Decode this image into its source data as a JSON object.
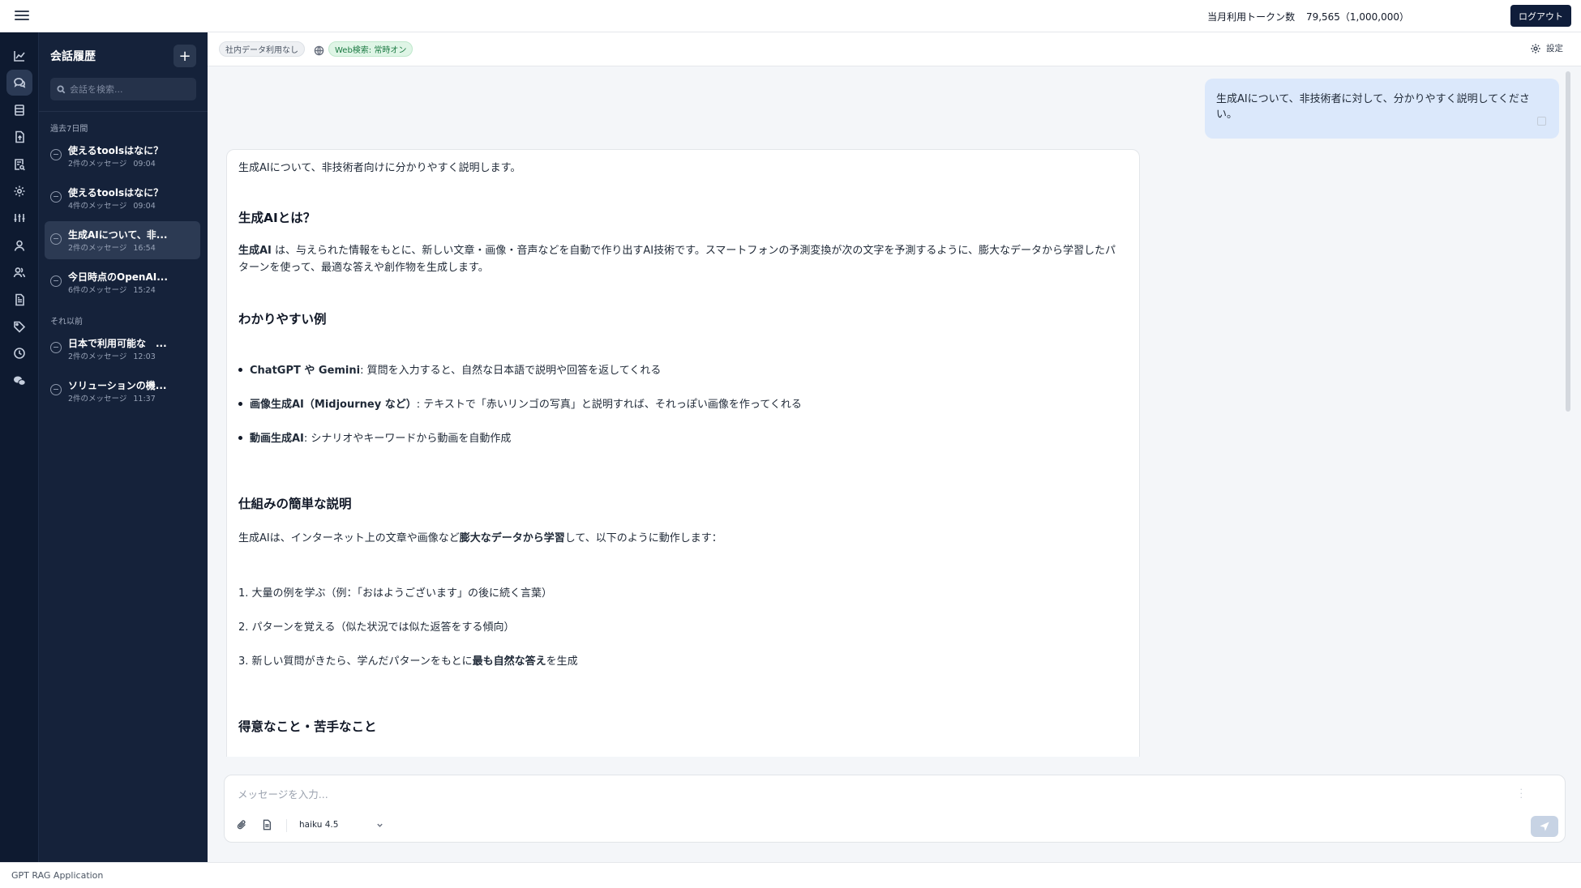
{
  "header": {
    "menu_icon": "hamburger-icon",
    "token_label": "当月利用トークン数",
    "token_value": "79,565（1,000,000）",
    "logout_label": "ログアウト"
  },
  "rail": {
    "items": [
      {
        "icon": "chart-line-icon"
      },
      {
        "icon": "chat-bubbles-icon",
        "active": true
      },
      {
        "icon": "table-icon"
      },
      {
        "icon": "document-upload-icon"
      },
      {
        "icon": "document-search-icon"
      },
      {
        "icon": "gear-icon"
      },
      {
        "icon": "sliders-icon"
      },
      {
        "icon": "user-icon"
      },
      {
        "icon": "users-icon"
      },
      {
        "icon": "document-text-icon"
      },
      {
        "icon": "tag-icon"
      },
      {
        "icon": "history-icon"
      },
      {
        "icon": "wechat-icon"
      }
    ]
  },
  "history": {
    "title": "会話履歴",
    "new_button": "+",
    "search_placeholder": "会話を検索...",
    "section_recent": "過去7日間",
    "section_older": "それ以前",
    "conversations": [
      {
        "title": "使えるtoolsはなに？",
        "count": "2件のメッセージ",
        "time": "09:04"
      },
      {
        "title": "使えるtoolsはなに？",
        "count": "4件のメッセージ",
        "time": "09:04"
      },
      {
        "title": "生成AIについて、非...",
        "count": "2件のメッセージ",
        "time": "16:54",
        "active": true
      },
      {
        "title": "今日時点のOpenAI...",
        "count": "6件のメッセージ",
        "time": "15:24"
      },
      {
        "title": "日本で利用可能な　...",
        "count": "2件のメッセージ",
        "time": "12:03"
      },
      {
        "title": "ソリューションの機...",
        "count": "2件のメッセージ",
        "time": "11:37"
      }
    ]
  },
  "chips": {
    "internal_data": "社内データ利用なし",
    "web_search": "Web検索: 常時オン",
    "settings_label": "設定"
  },
  "chat": {
    "user_message": "生成AIについて、非技術者に対して、分かりやすく説明してください。",
    "answer": {
      "intro": "生成AIについて、非技術者向けに分かりやすく説明します。",
      "h1": "生成AIとは？",
      "p1_bold": "生成AI",
      "p1_rest": " は、与えられた情報をもとに、新しい文章・画像・音声などを自動で作り出すAI技術です。スマートフォンの予測変換が次の文字を予測するように、膨大なデータから学習したパターンを使って、最適な答えや創作物を生成します。",
      "h2": "わかりやすい例",
      "ex1_bold": "ChatGPT や Gemini",
      "ex1_rest": ": 質問を入力すると、自然な日本語で説明や回答を返してくれる",
      "ex2_bold": "画像生成AI（Midjourney など）",
      "ex2_rest": ": テキストで「赤いリンゴの写真」と説明すれば、それっぽい画像を作ってくれる",
      "ex3_bold": "動画生成AI",
      "ex3_rest": ": シナリオやキーワードから動画を自動作成",
      "h3": "仕組みの簡単な説明",
      "p2_a": "生成AIは、インターネット上の文章や画像など",
      "p2_bold": "膨大なデータから学習",
      "p2_b": "して、以下のように動作します：",
      "step1": "1. 大量の例を学ぶ（例：「おはようございます」の後に続く言葉）",
      "step2": "2. パターンを覚える（似た状況では似た返答をする傾向）",
      "step3_a": "3. 新しい質問がきたら、学んだパターンをもとに",
      "step3_bold": "最も自然な答え",
      "step3_b": "を生成",
      "h4": "得意なこと・苦手なこと"
    }
  },
  "composer": {
    "placeholder": "メッセージを入力...",
    "model": "haiku 4.5"
  },
  "footer": {
    "app_name": "GPT RAG Application"
  }
}
